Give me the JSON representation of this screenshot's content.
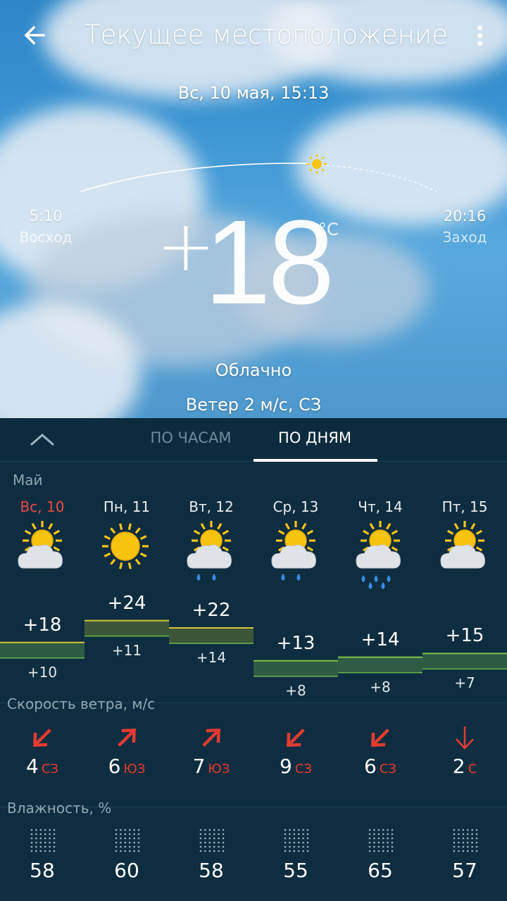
{
  "header": {
    "title": "Текущее местоположение"
  },
  "current": {
    "date": "Вс, 10 мая, 15:13",
    "sunrise_time": "5:10",
    "sunrise_label": "Восход",
    "sunset_time": "20:16",
    "sunset_label": "Заход",
    "temp_sign": "+",
    "temp_value": "18",
    "unit": "°C",
    "condition": "Облачно",
    "wind": "Ветер 2 м/с, СЗ"
  },
  "tabs": [
    {
      "label": "ПО ЧАСАМ",
      "active": false
    },
    {
      "label": "ПО ДНЯМ",
      "active": true
    }
  ],
  "forecast": {
    "month": "Май",
    "days": [
      {
        "name": "Вс, 10",
        "icon": "partly-cloudy-icon",
        "hi": "+18",
        "lo": "+10",
        "hi_val": 18,
        "lo_val": 10,
        "wind_speed": "4",
        "wind_dir": "СЗ",
        "humidity": "58"
      },
      {
        "name": "Пн, 11",
        "icon": "sunny-icon",
        "hi": "+24",
        "lo": "+11",
        "hi_val": 24,
        "lo_val": 11,
        "wind_speed": "6",
        "wind_dir": "ЮЗ",
        "humidity": "60"
      },
      {
        "name": "Вт, 12",
        "icon": "partly-cloudy-rain-icon",
        "hi": "+22",
        "lo": "+14",
        "hi_val": 22,
        "lo_val": 14,
        "wind_speed": "7",
        "wind_dir": "ЮЗ",
        "humidity": "58"
      },
      {
        "name": "Ср, 13",
        "icon": "partly-cloudy-rain-icon",
        "hi": "+13",
        "lo": "+8",
        "hi_val": 13,
        "lo_val": 8,
        "wind_speed": "9",
        "wind_dir": "СЗ",
        "humidity": "55"
      },
      {
        "name": "Чт, 14",
        "icon": "partly-cloudy-heavy-rain-icon",
        "hi": "+14",
        "lo": "+8",
        "hi_val": 14,
        "lo_val": 8,
        "wind_speed": "6",
        "wind_dir": "СЗ",
        "humidity": "65"
      },
      {
        "name": "Пт, 15",
        "icon": "partly-cloudy-icon",
        "hi": "+15",
        "lo": "+7",
        "hi_val": 15,
        "lo_val": 7,
        "wind_speed": "2",
        "wind_dir": "С",
        "humidity": "57"
      }
    ]
  },
  "wind_section": {
    "label": "Скорость ветра, м/с"
  },
  "humidity_section": {
    "label": "Влажность, %"
  },
  "colors": {
    "today": "#e84a40",
    "wind_dir": "#e23b32",
    "bar_fill": "#3a5a3a",
    "bar_edge": "#d4c63a"
  }
}
